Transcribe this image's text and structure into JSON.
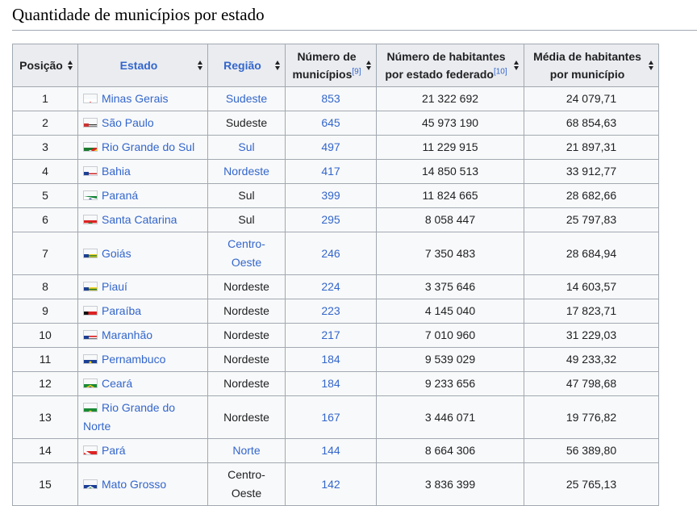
{
  "heading": "Quantidade de municípios por estado",
  "headers": {
    "posicao": "Posição",
    "estado": "Estado",
    "regiao": "Região",
    "municipios_line1": "Número de",
    "municipios_line2": "municípios",
    "municipios_ref": "[9]",
    "habitantes_line1": "Número de habitantes",
    "habitantes_line2": "por estado federado",
    "habitantes_ref": "[10]",
    "media_line1": "Média de habitantes",
    "media_line2": "por município"
  },
  "rows": [
    {
      "pos": "1",
      "estado": "Minas Gerais",
      "regiao": "Sudeste",
      "regiao_link": true,
      "municipios": "853",
      "habitantes": "21 322 692",
      "media": "24 079,71",
      "flag": "mg"
    },
    {
      "pos": "2",
      "estado": "São Paulo",
      "regiao": "Sudeste",
      "regiao_link": false,
      "municipios": "645",
      "habitantes": "45 973 190",
      "media": "68 854,63",
      "flag": "sp"
    },
    {
      "pos": "3",
      "estado": "Rio Grande do Sul",
      "regiao": "Sul",
      "regiao_link": true,
      "municipios": "497",
      "habitantes": "11 229 915",
      "media": "21 897,31",
      "flag": "rs"
    },
    {
      "pos": "4",
      "estado": "Bahia",
      "regiao": "Nordeste",
      "regiao_link": true,
      "municipios": "417",
      "habitantes": "14 850 513",
      "media": "33 912,77",
      "flag": "ba"
    },
    {
      "pos": "5",
      "estado": "Paraná",
      "regiao": "Sul",
      "regiao_link": false,
      "municipios": "399",
      "habitantes": "11 824 665",
      "media": "28 682,66",
      "flag": "pr"
    },
    {
      "pos": "6",
      "estado": "Santa Catarina",
      "regiao": "Sul",
      "regiao_link": false,
      "municipios": "295",
      "habitantes": "8 058 447",
      "media": "25 797,83",
      "flag": "sc"
    },
    {
      "pos": "7",
      "estado": "Goiás",
      "regiao_line1": "Centro-",
      "regiao_line2": "Oeste",
      "regiao_link": true,
      "municipios": "246",
      "habitantes": "7 350 483",
      "media": "28 684,94",
      "flag": "go"
    },
    {
      "pos": "8",
      "estado": "Piauí",
      "regiao": "Nordeste",
      "regiao_link": false,
      "municipios": "224",
      "habitantes": "3 375 646",
      "media": "14 603,57",
      "flag": "pi"
    },
    {
      "pos": "9",
      "estado": "Paraíba",
      "regiao": "Nordeste",
      "regiao_link": false,
      "municipios": "223",
      "habitantes": "4 145 040",
      "media": "17 823,71",
      "flag": "pb"
    },
    {
      "pos": "10",
      "estado": "Maranhão",
      "regiao": "Nordeste",
      "regiao_link": false,
      "municipios": "217",
      "habitantes": "7 010 960",
      "media": "31 229,03",
      "flag": "ma"
    },
    {
      "pos": "11",
      "estado": "Pernambuco",
      "regiao": "Nordeste",
      "regiao_link": false,
      "municipios": "184",
      "habitantes": "9 539 029",
      "media": "49 233,32",
      "flag": "pe"
    },
    {
      "pos": "12",
      "estado": "Ceará",
      "regiao": "Nordeste",
      "regiao_link": false,
      "municipios": "184",
      "habitantes": "9 233 656",
      "media": "47 798,68",
      "flag": "ce"
    },
    {
      "pos": "13",
      "estado_line1": "Rio Grande do",
      "estado_line2": "Norte",
      "regiao": "Nordeste",
      "regiao_link": false,
      "municipios": "167",
      "habitantes": "3 446 071",
      "media": "19 776,82",
      "flag": "rn"
    },
    {
      "pos": "14",
      "estado": "Pará",
      "regiao": "Norte",
      "regiao_link": true,
      "municipios": "144",
      "habitantes": "8 664 306",
      "media": "56 389,80",
      "flag": "pa"
    },
    {
      "pos": "15",
      "estado": "Mato Grosso",
      "regiao_line1": "Centro-",
      "regiao_line2": "Oeste",
      "regiao_link": false,
      "municipios": "142",
      "habitantes": "3 836 399",
      "media": "25 765,13",
      "flag": "mt"
    }
  ]
}
